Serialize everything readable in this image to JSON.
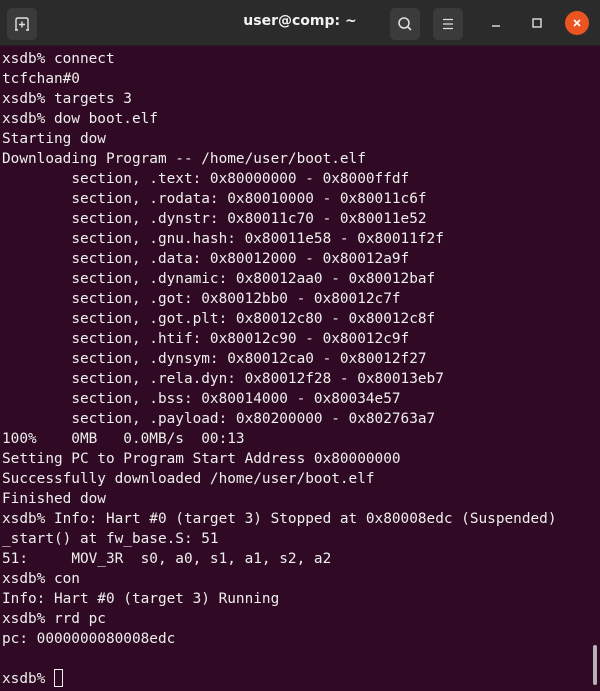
{
  "window": {
    "title": "user@comp: ~",
    "icons": {
      "new_tab": "new-tab-icon",
      "search": "search-icon",
      "menu": "hamburger-menu-icon",
      "minimize": "minimize-icon",
      "maximize": "maximize-icon",
      "close": "close-icon"
    },
    "colors": {
      "terminal_bg": "#300a24",
      "terminal_fg": "#eeeeec",
      "titlebar_bg": "#2b2b2b",
      "close_accent": "#e95420"
    }
  },
  "terminal": {
    "lines": [
      "xsdb% connect",
      "tcfchan#0",
      "xsdb% targets 3",
      "xsdb% dow boot.elf",
      "Starting dow",
      "Downloading Program -- /home/user/boot.elf",
      "\tsection, .text: 0x80000000 - 0x8000ffdf",
      "\tsection, .rodata: 0x80010000 - 0x80011c6f",
      "\tsection, .dynstr: 0x80011c70 - 0x80011e52",
      "\tsection, .gnu.hash: 0x80011e58 - 0x80011f2f",
      "\tsection, .data: 0x80012000 - 0x80012a9f",
      "\tsection, .dynamic: 0x80012aa0 - 0x80012baf",
      "\tsection, .got: 0x80012bb0 - 0x80012c7f",
      "\tsection, .got.plt: 0x80012c80 - 0x80012c8f",
      "\tsection, .htif: 0x80012c90 - 0x80012c9f",
      "\tsection, .dynsym: 0x80012ca0 - 0x80012f27",
      "\tsection, .rela.dyn: 0x80012f28 - 0x80013eb7",
      "\tsection, .bss: 0x80014000 - 0x80034e57",
      "\tsection, .payload: 0x80200000 - 0x802763a7",
      "100%    0MB   0.0MB/s  00:13",
      "Setting PC to Program Start Address 0x80000000",
      "Successfully downloaded /home/user/boot.elf",
      "Finished dow",
      "xsdb% Info: Hart #0 (target 3) Stopped at 0x80008edc (Suspended)",
      "_start() at fw_base.S: 51",
      "51:\tMOV_3R  s0, a0, s1, a1, s2, a2",
      "xsdb% con",
      "Info: Hart #0 (target 3) Running",
      "xsdb% rrd pc",
      "pc: 0000000080008edc",
      ""
    ],
    "prompt": "xsdb% ",
    "input_value": ""
  }
}
